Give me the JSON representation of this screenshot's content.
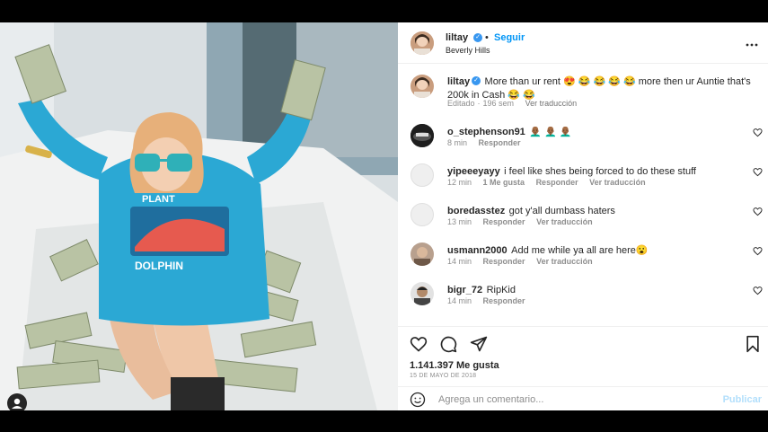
{
  "post": {
    "username": "liltay",
    "follow_label": "Seguir",
    "location": "Beverly Hills",
    "caption": "More than ur rent 😍 😂 😂 😂 😂 more then ur Auntie that's 200k in Cash 😂 😂",
    "edited": "Editado",
    "age": "196 sem",
    "translate": "Ver traducción"
  },
  "comments": [
    {
      "user": "o_stephenson91",
      "text": "👨🏾‍🦲 👨🏾‍🦲 👨🏾‍🦲",
      "time": "8 min",
      "likes": "",
      "reply": "Responder",
      "translate": ""
    },
    {
      "user": "yipeeeyayy",
      "text": "i feel like shes being forced to do these stuff",
      "time": "12 min",
      "likes": "1 Me gusta",
      "reply": "Responder",
      "translate": "Ver traducción"
    },
    {
      "user": "boredasstez",
      "text": "got y'all dumbass haters",
      "time": "13 min",
      "likes": "",
      "reply": "Responder",
      "translate": "Ver traducción"
    },
    {
      "user": "usmann2000",
      "text": "Add me while ya all are here😮",
      "time": "14 min",
      "likes": "",
      "reply": "Responder",
      "translate": "Ver traducción"
    },
    {
      "user": "bigr_72",
      "text": "RipKid",
      "time": "14 min",
      "likes": "",
      "reply": "Responder",
      "translate": ""
    }
  ],
  "stats": {
    "likes": "1.141.397 Me gusta",
    "date": "15 DE MAYO DE 2018"
  },
  "add_comment": {
    "placeholder": "Agrega un comentario...",
    "publish": "Publicar"
  },
  "icons": {
    "heart": "heart-icon",
    "comment": "comment-icon",
    "share": "share-icon",
    "save": "bookmark-icon",
    "more": "more-options-icon",
    "emoji": "emoji-icon",
    "user_tag": "user-tag-icon"
  },
  "colors": {
    "link_blue": "#0095f6",
    "muted": "#8e8e8e",
    "hoodie": "#2ba8d4",
    "publish_disabled": "#b2dffc"
  }
}
